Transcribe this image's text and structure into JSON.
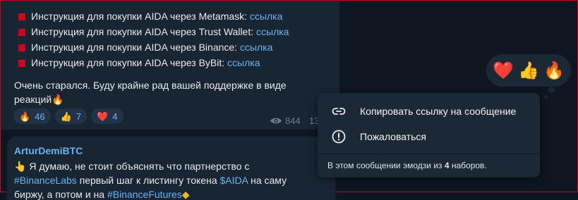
{
  "post": {
    "instructions": [
      {
        "text": "Инструкция для покупки AIDA через Metamask: ",
        "link": "ссылка"
      },
      {
        "text": "Инструкция для покупки AIDA через Trust Wallet: ",
        "link": "ссылка"
      },
      {
        "text": "Инструкция для покупки AIDA через Binance: ",
        "link": "ссылка"
      },
      {
        "text": "Инструкция для покупки AIDA через ByBit: ",
        "link": "ссылка"
      }
    ],
    "body_line1": "Очень старался. Буду крайне рад вашей поддержке в виде",
    "body_line2": "реакций",
    "body_emoji": "🔥",
    "reactions": [
      {
        "emoji": "🔥",
        "count": "46"
      },
      {
        "emoji": "👍",
        "count": "7"
      },
      {
        "emoji": "❤️",
        "count": "4"
      }
    ],
    "views": "844",
    "time": "13"
  },
  "comment": {
    "author": "ArturDemiBTC",
    "line1_emoji": "👆",
    "line1": " Я думаю, не стоит объяснять что партнерство с",
    "line2_tag": "#BinanceLabs",
    "line2_mid": " первый шаг к листингу токена ",
    "line2_cashtag": "$AIDA",
    "line2_end": " на саму",
    "line3_text": "биржу, а потом и на ",
    "line3_tag": "#BinanceFutures"
  },
  "emoji_bar": [
    "❤️",
    "👍",
    "🔥"
  ],
  "context_menu": {
    "copy_link": "Копировать ссылку на сообщение",
    "report": "Пожаловаться",
    "footer_pre": "В этом сообщении эмодзи из ",
    "footer_count": "4",
    "footer_post": " наборов."
  },
  "colors": {
    "background": "#0e1621",
    "bubble": "#182533",
    "link": "#6ab3f3",
    "menu": "#1b2836",
    "bullet": "#d1001c"
  },
  "icons": [
    "link-icon",
    "report-icon",
    "eye-icon",
    "bullet-square-icon"
  ]
}
